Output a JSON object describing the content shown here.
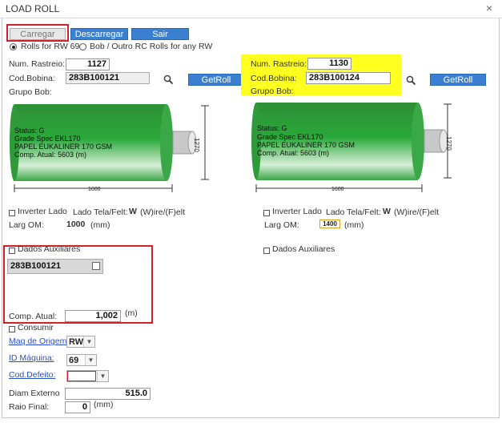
{
  "window": {
    "title": "LOAD ROLL",
    "close_glyph": "×"
  },
  "toolbar": {
    "carregar": "Carregar",
    "descarregar": "Descarregar",
    "sair": "Sair"
  },
  "source": {
    "option1": "Rolls for RW 69",
    "option2": "Bob / Outro RC Rolls for any RW",
    "selected": "option1"
  },
  "left": {
    "num_rastreio_label": "Num. Rastreio:",
    "num_rastreio": "1127",
    "cod_bobina_label": "Cod.Bobina:",
    "cod_bobina": "283B100121",
    "grupo_bob_label": "Grupo Bob:",
    "getroll": "GetRoll",
    "roll": {
      "status": "Status: G",
      "grade": "Grade Spec EKL170",
      "paper": "PAPEL EUKALINER 170 GSM",
      "comp": "Comp. Atual: 5603  (m)",
      "width": "1600",
      "height": "1270"
    },
    "inverter_label": "Inverter Lado",
    "lado_label": "Lado Tela/Felt:",
    "lado_value": "W",
    "lado_hint": "(W)ire/(F)elt",
    "larg_label": "Larg OM:",
    "larg_value": "1000",
    "larg_unit": "(mm)",
    "aux_label": "Dados Auxiliares",
    "aux_code": "283B100121",
    "comp_label": "Comp. Atual:",
    "comp_value": "1,002",
    "comp_unit": "(m)",
    "consumir_label": "Consumir",
    "maq_origem_label": "Maq de Origem:",
    "maq_origem_value": "RW",
    "id_maquina_label": "ID Máquina:",
    "id_maquina_value": "69",
    "cod_defeito_label": "Cod.Defeito:",
    "cod_defeito_value": "",
    "diam_label": "Diam Externo",
    "diam_value": "515.0",
    "raio_label": "Raio Final:",
    "raio_value": "0",
    "raio_unit": "(mm)"
  },
  "right": {
    "num_rastreio_label": "Num. Rastreio:",
    "num_rastreio": "1130",
    "cod_bobina_label": "Cod.Bobina:",
    "cod_bobina": "283B100124",
    "grupo_bob_label": "Grupo Bob:",
    "getroll": "GetRoll",
    "roll": {
      "status": "Status: G",
      "grade": "Grade Spec EKL170",
      "paper": "PAPEL EUKALINER 170 GSM",
      "comp": "Comp. Atual: 5603  (m)",
      "width": "1600",
      "height": "1270"
    },
    "inverter_label": "Inverter Lado",
    "lado_label": "Lado Tela/Felt:",
    "lado_value": "W",
    "lado_hint": "(W)ire/(F)elt",
    "larg_label": "Larg OM:",
    "larg_value": "1400",
    "larg_unit": "(mm)",
    "aux_label": "Dados Auxiliares"
  },
  "colors": {
    "highlight_yellow": "#ffff20",
    "highlight_red": "#d0202a",
    "button_blue": "#3b7fd1",
    "roll_green": "#1f9a2e"
  }
}
